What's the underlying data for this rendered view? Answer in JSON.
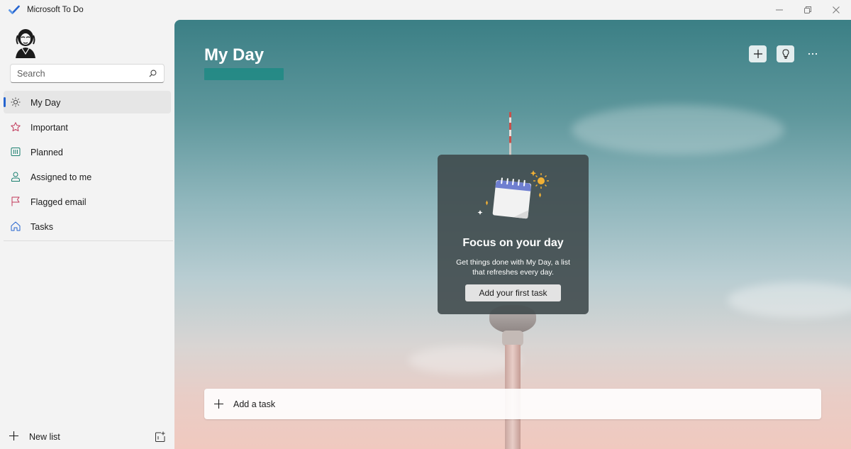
{
  "window": {
    "title": "Microsoft To Do",
    "controls": [
      "minimize",
      "restore",
      "close"
    ]
  },
  "sidebar": {
    "search_placeholder": "Search",
    "items": [
      {
        "label": "My Day",
        "icon": "sun-icon",
        "active": true
      },
      {
        "label": "Important",
        "icon": "star-icon",
        "active": false
      },
      {
        "label": "Planned",
        "icon": "calendar-grid-icon",
        "active": false
      },
      {
        "label": "Assigned to me",
        "icon": "person-icon",
        "active": false
      },
      {
        "label": "Flagged email",
        "icon": "flag-icon",
        "active": false
      },
      {
        "label": "Tasks",
        "icon": "home-icon",
        "active": false
      }
    ],
    "new_list_label": "New list"
  },
  "main": {
    "title": "My Day",
    "focus_card": {
      "title": "Focus on your day",
      "description": "Get things done with My Day, a list that refreshes every day.",
      "button_label": "Add your first task"
    },
    "add_task_label": "Add a task"
  },
  "colors": {
    "accent": "#2564cf",
    "important": "#c1385a",
    "planned": "#1a7f6f",
    "assigned": "#1a7f6f",
    "flagged": "#c1385a",
    "tasks": "#2564cf"
  }
}
